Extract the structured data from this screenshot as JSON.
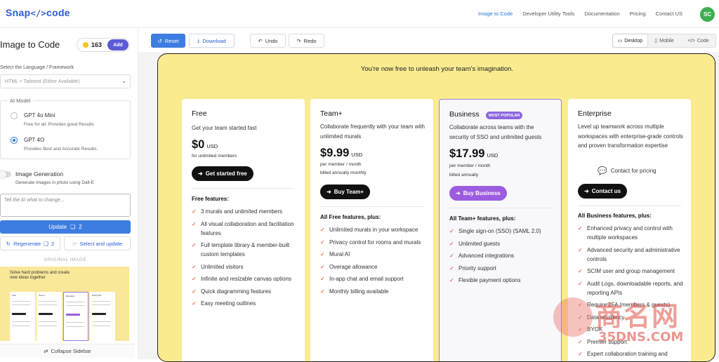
{
  "nav": {
    "logo": "Snap",
    "logo_code": "</>",
    "logo_suffix": "code",
    "links": [
      "Image to Code",
      "Developer Utility Tools",
      "Documentation",
      "Pricing",
      "Contact US"
    ],
    "avatar": "SC"
  },
  "sidebar": {
    "title": "Image to Code",
    "credits": "163",
    "add_label": "Add",
    "language_label": "Select the Language / Framework",
    "language_value": "HTML + Tailwind (Editor Available)",
    "ai_model_label": "AI Model",
    "models": [
      {
        "name": "GPT 4o Mini",
        "desc": "Free for all. Provides good Results",
        "selected": false
      },
      {
        "name": "GPT 4O",
        "desc": "Provides Best and Accurate Results.",
        "selected": true
      }
    ],
    "image_gen_label": "Image Generation",
    "image_gen_desc": "Generate Images in photo using Dall-E",
    "prompt_placeholder": "Tell the AI what to change...",
    "update_label": "Update",
    "update_count": "2",
    "regenerate_label": "Regenerate",
    "regenerate_count": "2",
    "select_update_label": "Select and update",
    "original_image_label": "ORIGINAL IMAGE",
    "thumb_title_1": "Solve hard problems and create",
    "thumb_title_2": "new ideas together",
    "thumb_cards": [
      "Free",
      "Team+",
      "Business",
      "Enterprise"
    ],
    "collapse_label": "Collapse Sidebar"
  },
  "toolbar": {
    "reset": "Reset",
    "download": "Download",
    "undo": "Undo",
    "redo": "Redo",
    "views": [
      "Desktop",
      "Mobile",
      "Code"
    ]
  },
  "preview": {
    "tagline": "You're now free to unleash your team's imagination.",
    "plans": [
      {
        "name": "Free",
        "desc": "Get your team started fast",
        "price": "$0",
        "currency": "USD",
        "sub1": "for unlimited members",
        "cta": "Get started free",
        "features_head": "Free features:",
        "features": [
          "3 murals and unlimited members",
          "All visual collaboration and facilitation features",
          "Full template library & member-built custom templates",
          "Unlimited visitors",
          "Infinite and resizable canvas options",
          "Quick diagramming features",
          "Easy meeting outlines"
        ]
      },
      {
        "name": "Team+",
        "desc": "Collaborate frequently with your team with unlimited murals",
        "price": "$9.99",
        "currency": "USD",
        "sub1": "per member / month",
        "sub2": "billed annually monthly",
        "cta": "Buy Team+",
        "features_head": "All Free features, plus:",
        "features": [
          "Unlimited murals in your workspace",
          "Privacy control for rooms and murals",
          "Mural AI",
          "Overage allowance",
          "In-app chat and email support",
          "Monthly billing available"
        ]
      },
      {
        "name": "Business",
        "badge": "MOST POPULAR",
        "desc": "Collaborate across teams with the security of SSO and unlimited guests",
        "price": "$17.99",
        "currency": "USD",
        "sub1": "per member / month",
        "sub2": "billed annually",
        "cta": "Buy Business",
        "features_head": "All Team+ features, plus:",
        "features": [
          "Single sign-on (SSO) (SAML 2.0)",
          "Unlimited guests",
          "Advanced integrations",
          "Priority support",
          "Flexible payment options"
        ]
      },
      {
        "name": "Enterprise",
        "desc": "Level up teamwork across multiple workspaces with enterprise-grade controls and proven transformation expertise",
        "contact": "Contact for pricing",
        "cta": "Contact us",
        "features_head": "All Business features, plus:",
        "features": [
          "Enhanced privacy and control with multiple workspaces",
          "Advanced security and administrative controls",
          "SCIM user and group management",
          "Audit Logs, downloadable reports, and reporting APIs",
          "Require 2FA (members & guests)",
          "Data residency",
          "BYOK",
          "Premier support",
          "Expert collaboration training and"
        ]
      }
    ]
  },
  "watermark": {
    "text": "商名网",
    "domain": "35DNS.COM"
  },
  "colors": {
    "accent_blue": "#3d7de0",
    "preview_bg": "#faeb8f",
    "check_red": "#d6372c",
    "popular_purple": "#8d66e0"
  }
}
